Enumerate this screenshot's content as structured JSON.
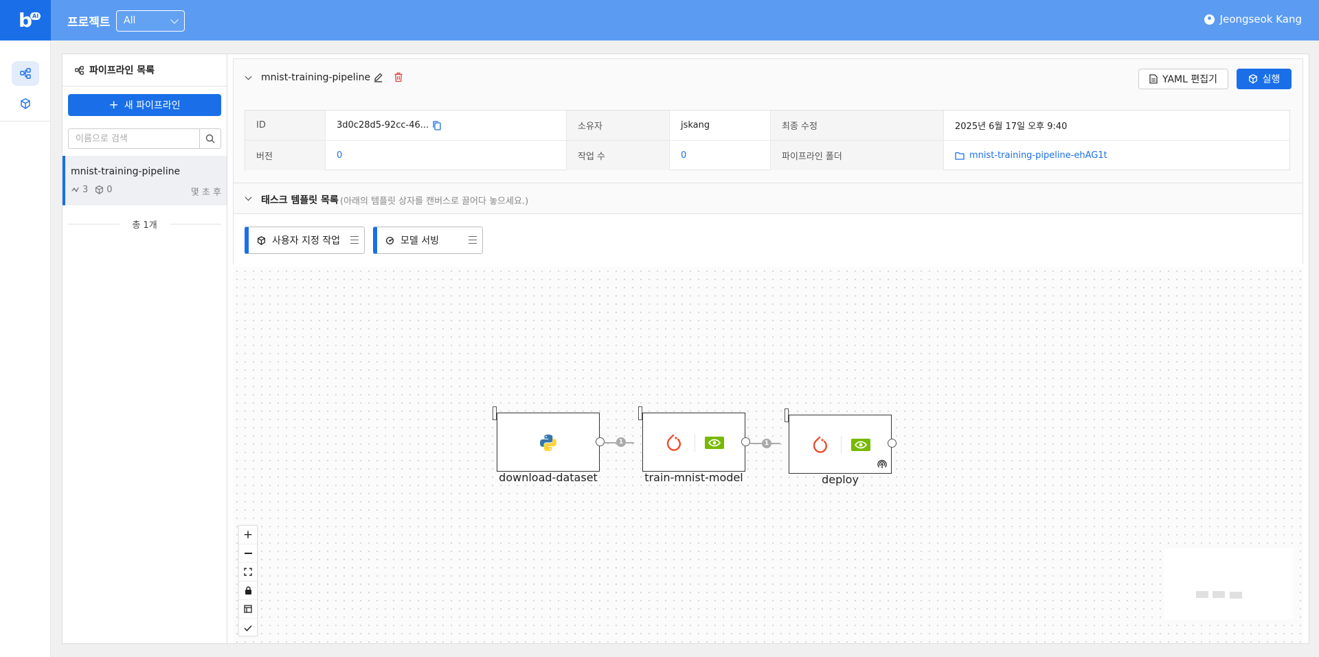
{
  "header": {
    "logo_text": "b",
    "logo_badge": "AI",
    "project_label": "프로젝트",
    "project_select_value": "All",
    "user_name": "Jeongseok Kang"
  },
  "sidebar": {
    "title": "파이프라인 목록",
    "new_button_label": "새 파이프라인",
    "search_placeholder": "이름으로 검색",
    "items": [
      {
        "name": "mnist-training-pipeline",
        "task_count": "3",
        "run_count": "0",
        "time": "몇 초 후"
      }
    ],
    "total_label": "총 1개"
  },
  "pipeline": {
    "title": "mnist-training-pipeline",
    "yaml_button": "YAML 편집기",
    "run_button": "실행",
    "info": {
      "id_label": "ID",
      "id_value": "3d0c28d5-92cc-46...",
      "owner_label": "소유자",
      "owner_value": "jskang",
      "modified_label": "최종 수정",
      "modified_value": "2025년 6월 17일 오후 9:40",
      "version_label": "버전",
      "version_value": "0",
      "jobs_label": "작업 수",
      "jobs_value": "0",
      "folder_label": "파이프라인 폴더",
      "folder_value": "mnist-training-pipeline-ehAG1t"
    }
  },
  "templates": {
    "title": "태스크 템플릿 목록",
    "hint": "(아래의 템플릿 상자를 캔버스로 끌어다 놓으세요.)",
    "items": [
      {
        "label": "사용자 지정 작업",
        "icon": "cube-icon"
      },
      {
        "label": "모델 서빙",
        "icon": "serving-icon"
      }
    ]
  },
  "canvas": {
    "nodes": [
      {
        "label": "download-dataset",
        "icons": [
          "python-icon"
        ]
      },
      {
        "label": "train-mnist-model",
        "icons": [
          "pytorch-icon",
          "nvidia-icon"
        ]
      },
      {
        "label": "deploy",
        "icons": [
          "pytorch-icon",
          "nvidia-icon",
          "broadcast-icon"
        ]
      }
    ],
    "edges": [
      {
        "from": "download-dataset",
        "to": "train-mnist-model",
        "badge": "1"
      },
      {
        "from": "train-mnist-model",
        "to": "deploy",
        "badge": "1"
      }
    ],
    "controls": [
      "zoom-in",
      "zoom-out",
      "fit-view",
      "lock",
      "toggle-panel",
      "check"
    ]
  },
  "colors": {
    "topbar": "#5b9cf2",
    "primary": "#1a6fe8",
    "pytorch": "#ee4c2c",
    "nvidia": "#76b900",
    "python_blue": "#3776ab",
    "python_yellow": "#ffd43b"
  }
}
